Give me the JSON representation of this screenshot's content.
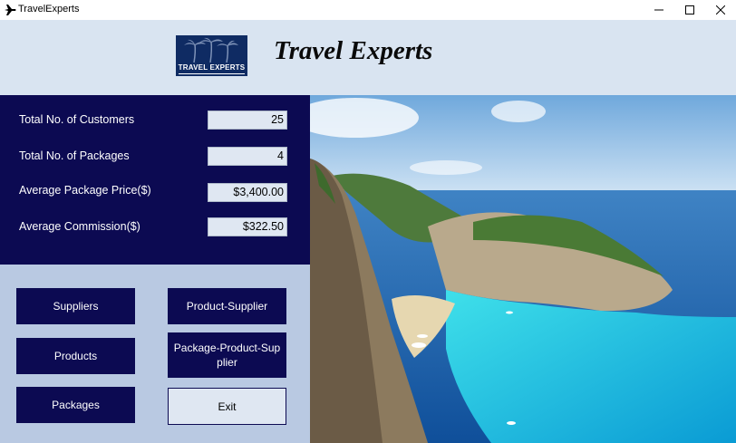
{
  "window": {
    "title": "TravelExperts",
    "controls": {
      "minimize_icon": "minimize-icon",
      "maximize_icon": "maximize-icon",
      "close_icon": "close-icon"
    }
  },
  "header": {
    "logo_text": "TRAVEL EXPERTS",
    "heading": "Travel Experts"
  },
  "stats": [
    {
      "label": "Total No. of Customers",
      "value": "25"
    },
    {
      "label": "Total No. of Packages",
      "value": "4"
    },
    {
      "label": "Average Package Price($)",
      "value": "$3,400.00"
    },
    {
      "label": "Average Commission($)",
      "value": "$322.50"
    }
  ],
  "buttons": {
    "suppliers": "Suppliers",
    "product_supplier": "Product-Supplier",
    "products": "Products",
    "package_product_supplier": "Package-Product-Sup plier",
    "packages": "Packages",
    "exit": "Exit"
  },
  "colors": {
    "header_bg": "#d9e4f1",
    "panel_navy": "#0c0a52",
    "buttons_bg": "#b9c9e2",
    "field_bg": "#dfe7f2"
  }
}
